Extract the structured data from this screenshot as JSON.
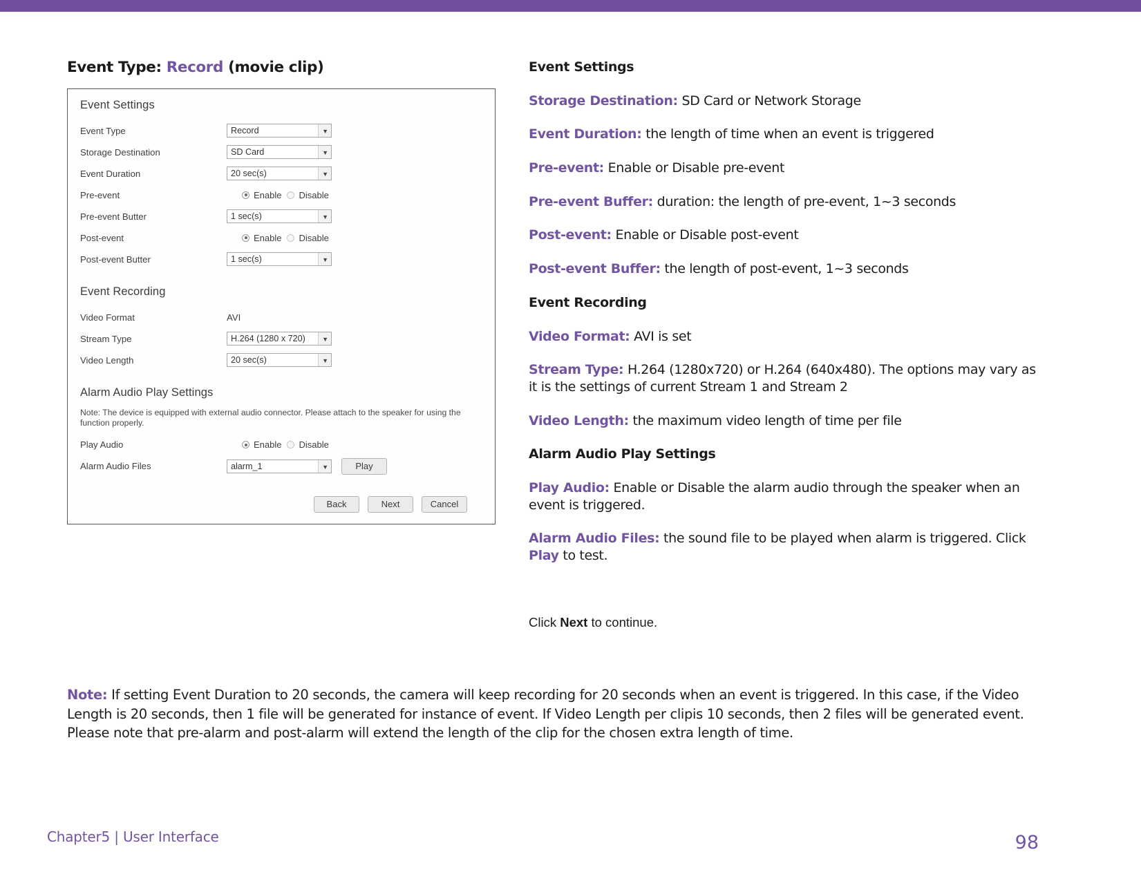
{
  "theme": {
    "accent": "#71519E",
    "term_color": "#7354A0",
    "body_text": "#1C1C1C"
  },
  "caption": {
    "prefix": "Event Type:",
    "highlight": "Record",
    "suffix": "(movie clip)"
  },
  "screenshot": {
    "event_settings": {
      "title": "Event Settings",
      "rows": [
        {
          "label": "Event Type",
          "value": "Record",
          "control": "select"
        },
        {
          "label": "Storage Destination",
          "value": "SD Card",
          "control": "select"
        },
        {
          "label": "Event Duration",
          "value": "20 sec(s)",
          "control": "select"
        },
        {
          "label": "Pre-event",
          "control": "radio",
          "options": [
            "Enable",
            "Disable"
          ],
          "selected": "Enable"
        },
        {
          "label": "Pre-event Butter",
          "value": "1 sec(s)",
          "control": "select"
        },
        {
          "label": "Post-event",
          "control": "radio",
          "options": [
            "Enable",
            "Disable"
          ],
          "selected": "Enable"
        },
        {
          "label": "Post-event Butter",
          "value": "1 sec(s)",
          "control": "select"
        }
      ]
    },
    "event_recording": {
      "title": "Event Recording",
      "rows": [
        {
          "label": "Video Format",
          "value": "AVI",
          "control": "text"
        },
        {
          "label": "Stream Type",
          "value": "H.264 (1280 x 720)",
          "control": "select"
        },
        {
          "label": "Video Length",
          "value": "20 sec(s)",
          "control": "select"
        }
      ]
    },
    "alarm_audio": {
      "title": "Alarm Audio Play Settings",
      "note": "Note: The device is equipped with external audio connector. Please attach to the speaker for using the function properly.",
      "rows": [
        {
          "label": "Play Audio",
          "control": "radio",
          "options": [
            "Enable",
            "Disable"
          ],
          "selected": "Enable"
        },
        {
          "label": "Alarm Audio Files",
          "value": "alarm_1",
          "control": "select",
          "button": "Play"
        }
      ]
    },
    "footer_buttons": [
      "Back",
      "Next",
      "Cancel"
    ]
  },
  "descriptions": [
    {
      "kind": "head",
      "text": "Event Settings"
    },
    {
      "kind": "term",
      "term": "Storage Destination:",
      "text": "SD Card or Network Storage"
    },
    {
      "kind": "term",
      "term": "Event Duration:",
      "text": "the length of time when an event is triggered"
    },
    {
      "kind": "term",
      "term": "Pre-event:",
      "text": "Enable or Disable pre-event"
    },
    {
      "kind": "term",
      "term": "Pre-event Buffer:",
      "text": "duration: the length of pre-event, 1~3 seconds"
    },
    {
      "kind": "term",
      "term": "Post-event:",
      "text": "Enable or Disable post-event"
    },
    {
      "kind": "term",
      "term": "Post-event Buffer:",
      "text": "the length of post-event, 1~3 seconds"
    },
    {
      "kind": "head",
      "text": "Event Recording"
    },
    {
      "kind": "term",
      "term": "Video Format:",
      "text": "AVI is set"
    },
    {
      "kind": "term",
      "term": "Stream Type:",
      "text": "H.264 (1280x720) or H.264 (640x480). The options may vary as it is the settings of current Stream 1 and Stream 2"
    },
    {
      "kind": "term",
      "term": "Video Length:",
      "text": "the maximum video length of time per file"
    },
    {
      "kind": "head",
      "text": "Alarm Audio Play Settings"
    },
    {
      "kind": "term",
      "term": "Play Audio:",
      "text": "Enable or Disable the alarm audio through the speaker when an event is triggered."
    },
    {
      "kind": "term-kw",
      "term": "Alarm Audio Files:",
      "text": "the sound file to be played when alarm is triggered. Click ",
      "keyword": "Play",
      "text_after": " to test."
    }
  ],
  "continue_line": {
    "before": "Click ",
    "bold": "Next",
    "after": " to continue."
  },
  "note": {
    "label": "Note:",
    "text": "If setting Event Duration to 20 seconds, the camera will keep recording for 20 seconds when an event is triggered. In this case, if the Video Length is 20 seconds, then 1 file will be generated for instance of event. If Video Length per clipis 10 seconds, then 2 files will be generated event. Please note that pre-alarm and post-alarm will extend the length of the clip for the chosen extra length of time."
  },
  "footer": {
    "chapter": "Chapter5  |  User Interface",
    "page": "98"
  }
}
